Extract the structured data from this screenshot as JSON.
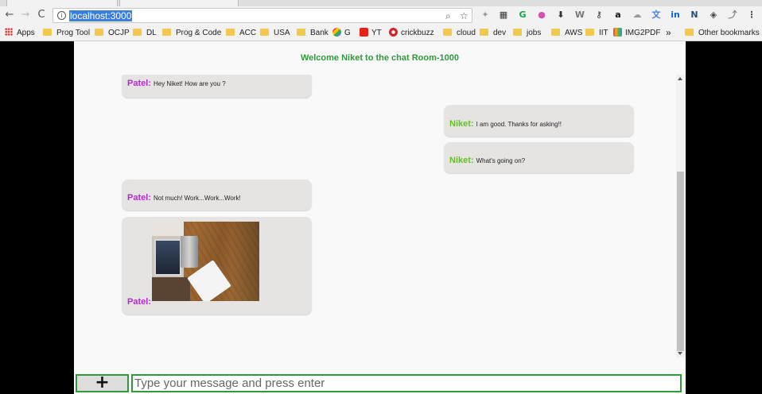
{
  "browser": {
    "url": "localhost:3000",
    "nav": {
      "back": "←",
      "forward": "→",
      "reload": "C"
    },
    "omnibox_icons": {
      "search": "⌕",
      "star": "☆"
    },
    "extensions": [
      {
        "name": "puzzle-icon",
        "glyph": "✦",
        "color": "#9a9a9a"
      },
      {
        "name": "grid-icon",
        "glyph": "▦",
        "color": "#333333"
      },
      {
        "name": "grammarly-icon",
        "glyph": "G",
        "color": "#15a34a"
      },
      {
        "name": "color-wheel-icon",
        "glyph": "●",
        "color": "#d94fb0"
      },
      {
        "name": "download-icon",
        "glyph": "⬇",
        "color": "#333333"
      },
      {
        "name": "w-icon",
        "glyph": "W",
        "color": "#777777"
      },
      {
        "name": "key-icon",
        "glyph": "⚷",
        "color": "#333333"
      },
      {
        "name": "amazon-icon",
        "glyph": "a",
        "color": "#111111"
      },
      {
        "name": "cloud-icon",
        "glyph": "☁",
        "color": "#999999"
      },
      {
        "name": "translate-icon",
        "glyph": "文",
        "color": "#4a7fd6"
      },
      {
        "name": "linkedin-icon",
        "glyph": "in",
        "color": "#0a66c2"
      },
      {
        "name": "n-icon",
        "glyph": "N",
        "color": "#1f4e79"
      },
      {
        "name": "shield-icon",
        "glyph": "◈",
        "color": "#444444"
      },
      {
        "name": "pdf-icon",
        "glyph": "⤴",
        "color": "#888888"
      },
      {
        "name": "menu-icon",
        "glyph": "⋮",
        "color": "#444444"
      }
    ]
  },
  "bookmarks": {
    "apps": "Apps",
    "items": [
      {
        "label": "Prog Tool",
        "icon": "folder"
      },
      {
        "label": "OCJP",
        "icon": "folder"
      },
      {
        "label": "DL",
        "icon": "folder"
      },
      {
        "label": "Prog & Code",
        "icon": "folder"
      },
      {
        "label": "ACC",
        "icon": "folder"
      },
      {
        "label": "USA",
        "icon": "folder"
      },
      {
        "label": "Bank",
        "icon": "folder"
      },
      {
        "label": "G",
        "icon": "google"
      },
      {
        "label": "YT",
        "icon": "youtube"
      },
      {
        "label": "crickbuzz",
        "icon": "crickbuzz"
      },
      {
        "label": "cloud",
        "icon": "folder"
      },
      {
        "label": "dev",
        "icon": "folder"
      },
      {
        "label": "jobs",
        "icon": "folder"
      },
      {
        "label": "AWS",
        "icon": "folder"
      },
      {
        "label": "IIT",
        "icon": "folder"
      },
      {
        "label": "IMG2PDF",
        "icon": "img2pdf"
      }
    ],
    "overflow": "»",
    "other": "Other bookmarks"
  },
  "chat": {
    "welcome": "Welcome Niket to the chat Room-1000",
    "messages": [
      {
        "sender": "Patel:",
        "text": "Hey Niket! How are you ?",
        "side": "left",
        "kind": "text"
      },
      {
        "sender": "Niket:",
        "text": "I am good. Thanks for asking!!",
        "side": "right",
        "kind": "text"
      },
      {
        "sender": "Niket:",
        "text": "What's going on?",
        "side": "right",
        "kind": "text"
      },
      {
        "sender": "Patel:",
        "text": "Not much! Work...Work...Work!",
        "side": "left",
        "kind": "text"
      },
      {
        "sender": "Patel:",
        "text": "",
        "side": "left",
        "kind": "image"
      }
    ]
  },
  "composer": {
    "attach_label": "+",
    "placeholder": "Type your message and press enter",
    "value": ""
  },
  "colors": {
    "accent_green": "#2e9a3a",
    "patel": "#b12bd3",
    "niket": "#5ec319",
    "bubble": "#e6e4e3"
  }
}
